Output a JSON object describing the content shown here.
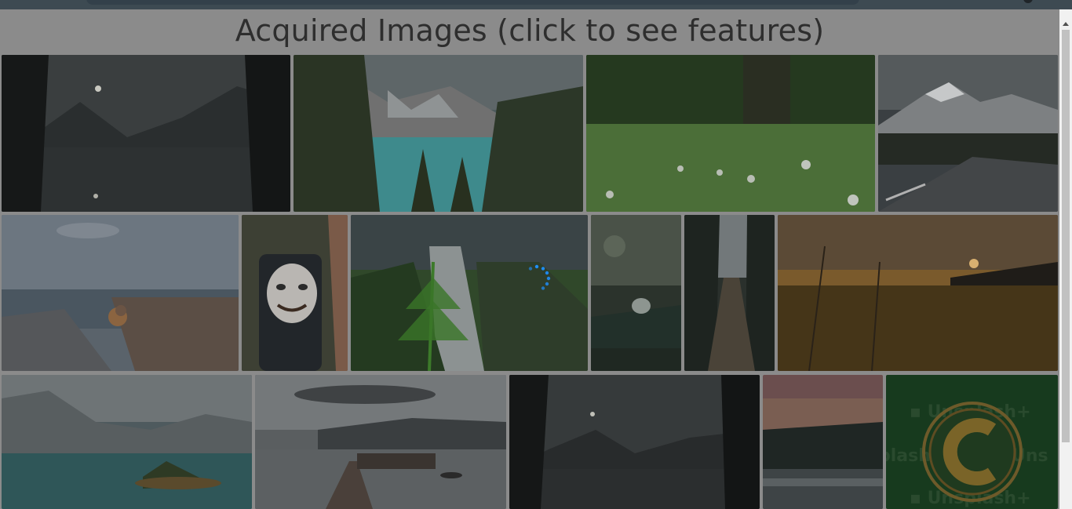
{
  "page": {
    "title": "Acquired Images (click to see features)"
  },
  "gallery": {
    "images": [
      {
        "name": "moonlit-lake"
      },
      {
        "name": "turquoise-mountain-lake"
      },
      {
        "name": "grass-meadow-daisies"
      },
      {
        "name": "mountain-road"
      },
      {
        "name": "pier-with-robin"
      },
      {
        "name": "masked-backpack"
      },
      {
        "name": "waterfall-fir"
      },
      {
        "name": "water-droplet-leaf"
      },
      {
        "name": "forest-path"
      },
      {
        "name": "sunset-grass-field"
      },
      {
        "name": "cloudy-lake-island"
      },
      {
        "name": "wooden-dock"
      },
      {
        "name": "dark-moonlit-lake"
      },
      {
        "name": "misty-forest-dusk"
      },
      {
        "name": "unsplash-plus-logo"
      }
    ],
    "watermark_text": "Unsplash+",
    "logo_letter": "C"
  },
  "colors": {
    "overlay": "#8b8b8b",
    "spinner": "#1e90ff",
    "title": "#2e2e2e"
  }
}
